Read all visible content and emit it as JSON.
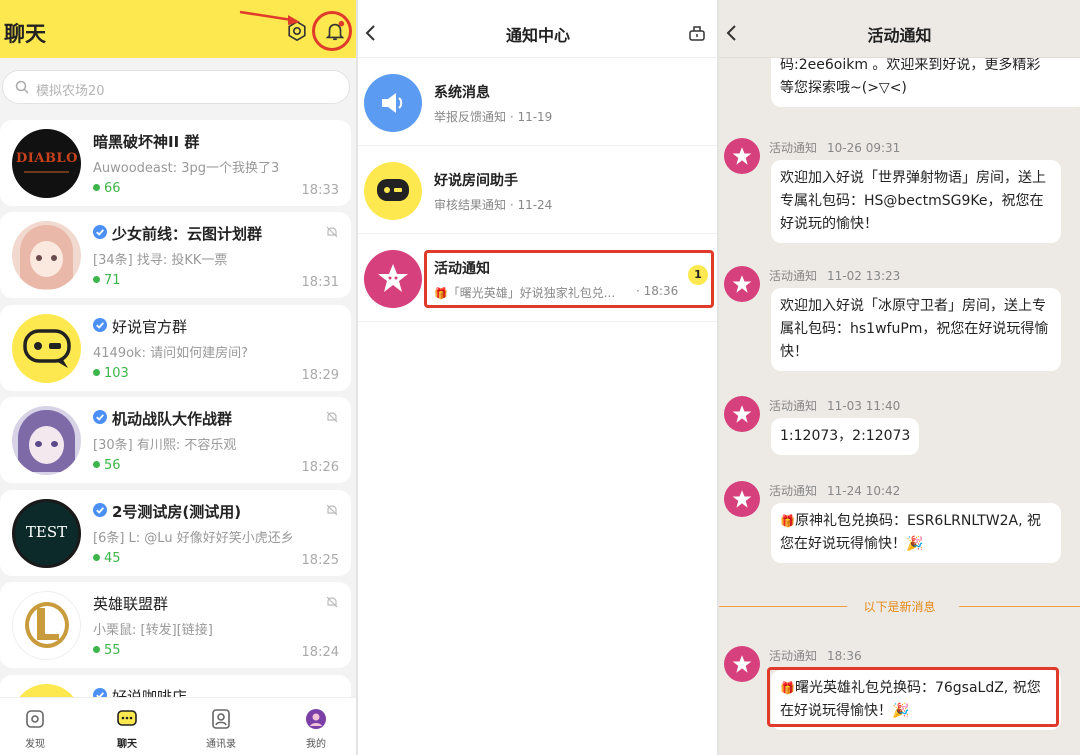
{
  "chats_panel": {
    "title": "聊天",
    "search_placeholder": "模拟农场20",
    "chats": [
      {
        "name": "暗黑破坏神II 群",
        "last_message": "Auwoodeast: 3pg一个我换了3",
        "online": "66",
        "time": "18:33",
        "verified": false,
        "muted": false
      },
      {
        "name": "少女前线：云图计划群",
        "last_message": "[34条] 找寻: 投KK一票",
        "online": "71",
        "time": "18:31",
        "verified": true,
        "muted": true
      },
      {
        "name": "好说官方群",
        "last_message": "4149ok: 请问如何建房间?",
        "online": "103",
        "time": "18:29",
        "verified": true,
        "muted": false
      },
      {
        "name": "机动战队大作战群",
        "last_message": "[30条] 有川熙: 不容乐观",
        "online": "56",
        "time": "18:26",
        "verified": true,
        "muted": true
      },
      {
        "name": "2号测试房(测试用)",
        "last_message": "[6条] L: @Lu 好像好好笑小虎还乡",
        "online": "45",
        "time": "18:25",
        "verified": true,
        "muted": true
      },
      {
        "name": "英雄联盟群",
        "last_message": "小栗鼠: [转发][链接]",
        "online": "55",
        "time": "18:24",
        "verified": false,
        "muted": true
      },
      {
        "name": "好说咖啡店",
        "verified": true
      }
    ],
    "avatar_texts": {
      "test": "TEST",
      "diablo": "DIABLO"
    },
    "bottom_nav": [
      {
        "label": "发现",
        "icon": "discover-icon"
      },
      {
        "label": "聊天",
        "icon": "chat-icon"
      },
      {
        "label": "通讯录",
        "icon": "contacts-icon"
      },
      {
        "label": "我的",
        "icon": "profile-icon"
      }
    ]
  },
  "notice_panel": {
    "title": "通知中心",
    "items": [
      {
        "title": "系统消息",
        "subtitle": "举报反馈通知 · 11-19",
        "icon": "speaker-icon"
      },
      {
        "title": "好说房间助手",
        "subtitle": "审核结果通知 · 11-24",
        "icon": "gamepad-icon"
      },
      {
        "title": "活动通知",
        "subtitle": "「曙光英雄」好说独家礼包兑...",
        "time": "· 18:36",
        "badge": "1",
        "icon": "star-icon"
      }
    ]
  },
  "activity_panel": {
    "title": "活动通知",
    "top_partial": "码:2ee6oikm 。欢迎来到好说，更多精彩\n等您探索哦~(>▽<)",
    "sender": "活动通知",
    "messages": [
      {
        "time": "10-26 09:31",
        "text": "欢迎加入好说「世界弹射物语」房间，送上专属礼包码：HS@bectmSG9Ke，祝您在好说玩的愉快！"
      },
      {
        "time": "11-02 13:23",
        "text": "欢迎加入好说「冰原守卫者」房间，送上专属礼包码：hs1wfuPm，祝您在好说玩得愉快！"
      },
      {
        "time": "11-03 11:40",
        "text": "1:12073，2:12073"
      },
      {
        "time": "11-24 10:42",
        "text": "原神礼包兑换码：ESR6LRNLTW2A, 祝您在好说玩得愉快！🎉"
      },
      {
        "time": "18:36",
        "text": "曙光英雄礼包兑换码：76gsaLdZ, 祝您在好说玩得愉快！🎉"
      }
    ],
    "new_messages_divider": "以下是新消息"
  },
  "colors": {
    "brand_yellow": "#fde94f",
    "online_green": "#3cb54a",
    "annotation_red": "#e03a2b",
    "divider_orange": "#f0a040"
  }
}
